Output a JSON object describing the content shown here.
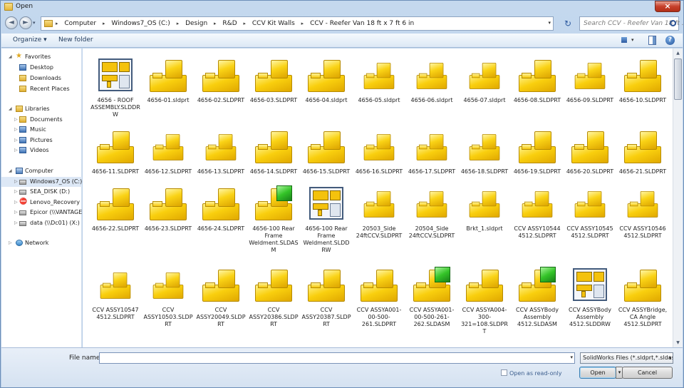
{
  "window": {
    "title": "Open",
    "close_glyph": "×"
  },
  "nav_buttons": {
    "back_glyph": "◄",
    "forward_glyph": "►",
    "dropdown_glyph": "▾"
  },
  "address": {
    "crumbs": [
      "Computer",
      "Windows7_OS (C:)",
      "Design",
      "R&D",
      "CCV Kit Walls",
      "CCV - Reefer Van 18 ft x 7 ft 6 in"
    ],
    "separator": "▸",
    "dropdown_glyph": "▾",
    "refresh_glyph": "↻"
  },
  "search": {
    "placeholder": "Search CCV - Reefer Van 18 ft ..."
  },
  "toolbar": {
    "organize": "Organize ▾",
    "new_folder": "New folder",
    "help_glyph": "?"
  },
  "sidebar": {
    "favorites": "Favorites",
    "favorite_items": [
      "Desktop",
      "Downloads",
      "Recent Places"
    ],
    "libraries": "Libraries",
    "library_items": [
      "Documents",
      "Music",
      "Pictures",
      "Videos"
    ],
    "computer": "Computer",
    "computer_items": [
      "Windows7_OS (C:)",
      "SEA_DISK (D:)",
      "Lenovo_Recovery (Q",
      "Epicor (\\\\VANTAGE)",
      "data (\\\\Dc01) (X:)"
    ],
    "network": "Network"
  },
  "files": [
    {
      "name": "4656 - ROOF ASSEMBLY.SLDDRW",
      "kind": "drawing"
    },
    {
      "name": "4656-01.sldprt",
      "kind": "part"
    },
    {
      "name": "4656-02.SLDPRT",
      "kind": "part"
    },
    {
      "name": "4656-03.SLDPRT",
      "kind": "part"
    },
    {
      "name": "4656-04.sldprt",
      "kind": "part"
    },
    {
      "name": "4656-05.sldprt",
      "kind": "part-small"
    },
    {
      "name": "4656-06.sldprt",
      "kind": "part-small"
    },
    {
      "name": "4656-07.sldprt",
      "kind": "part-small"
    },
    {
      "name": "4656-08.SLDPRT",
      "kind": "part"
    },
    {
      "name": "4656-09.SLDPRT",
      "kind": "part-small"
    },
    {
      "name": "4656-10.SLDPRT",
      "kind": "part"
    },
    {
      "name": "4656-11.SLDPRT",
      "kind": "part"
    },
    {
      "name": "4656-12.SLDPRT",
      "kind": "part-small"
    },
    {
      "name": "4656-13.SLDPRT",
      "kind": "part-small"
    },
    {
      "name": "4656-14.SLDPRT",
      "kind": "part"
    },
    {
      "name": "4656-15.SLDPRT",
      "kind": "part"
    },
    {
      "name": "4656-16.SLDPRT",
      "kind": "part-small"
    },
    {
      "name": "4656-17.SLDPRT",
      "kind": "part-small"
    },
    {
      "name": "4656-18.SLDPRT",
      "kind": "part-small"
    },
    {
      "name": "4656-19.SLDPRT",
      "kind": "part"
    },
    {
      "name": "4656-20.SLDPRT",
      "kind": "part"
    },
    {
      "name": "4656-21.SLDPRT",
      "kind": "part"
    },
    {
      "name": "4656-22.SLDPRT",
      "kind": "part"
    },
    {
      "name": "4656-23.SLDPRT",
      "kind": "part"
    },
    {
      "name": "4656-24.SLDPRT",
      "kind": "part"
    },
    {
      "name": "4656-100 Rear Frame Weldment.SLDASM",
      "kind": "assembly"
    },
    {
      "name": "4656-100 Rear Frame Weldment.SLDDRW",
      "kind": "drawing"
    },
    {
      "name": "20503_Side 24ftCCV.SLDPRT",
      "kind": "part-small"
    },
    {
      "name": "20504_Side 24ftCCV.SLDPRT",
      "kind": "part-small"
    },
    {
      "name": "Brkt_1.sldprt",
      "kind": "part-small"
    },
    {
      "name": "CCV ASSY10544 4512.SLDPRT",
      "kind": "part-small"
    },
    {
      "name": "CCV ASSY10545 4512.SLDPRT",
      "kind": "part-small"
    },
    {
      "name": "CCV ASSY10546 4512.SLDPRT",
      "kind": "part-small"
    },
    {
      "name": "CCV ASSY10547 4512.SLDPRT",
      "kind": "part-small"
    },
    {
      "name": "CCV ASSY10503.SLDPRT",
      "kind": "part-small"
    },
    {
      "name": "CCV ASSY20049.SLDPRT",
      "kind": "part"
    },
    {
      "name": "CCV ASSY20386.SLDPRT",
      "kind": "part"
    },
    {
      "name": "CCV ASSY20387.SLDPRT",
      "kind": "part"
    },
    {
      "name": "CCV ASSYA001-00-500-261.SLDPRT",
      "kind": "part"
    },
    {
      "name": "CCV ASSYA001-00-500-261-262.SLDASM",
      "kind": "assembly"
    },
    {
      "name": "CCV ASSYA004-300-321=108.SLDPRT",
      "kind": "part"
    },
    {
      "name": "CCV ASSYBody Assembly 4512.SLDASM",
      "kind": "assembly"
    },
    {
      "name": "CCV ASSYBody Assembly 4512.SLDDRW",
      "kind": "drawing"
    },
    {
      "name": "CCV ASSYBridge, CA Angle 4512.SLDPRT",
      "kind": "part"
    }
  ],
  "scrollbar": {
    "up_glyph": "▲",
    "down_glyph": "▼"
  },
  "bottom": {
    "file_name_label": "File name:",
    "file_name_value": "",
    "file_type": "SolidWorks Files (*.sldprt,*.sldas",
    "read_only": "Open as read-only",
    "open": "Open",
    "open_split_glyph": "▾",
    "cancel": "Cancel"
  }
}
